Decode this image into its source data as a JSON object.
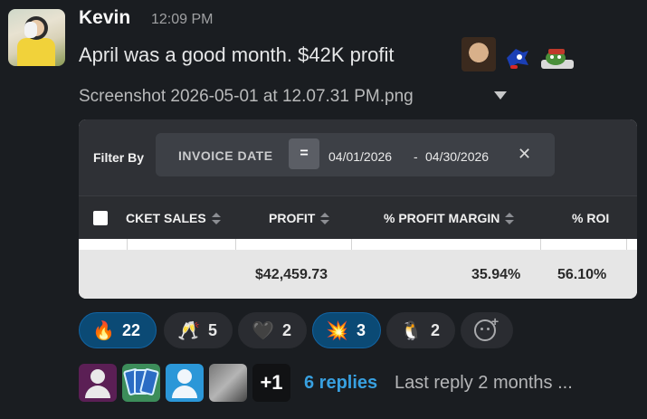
{
  "message": {
    "sender": "Kevin",
    "time": "12:09 PM",
    "text": "April was a good month. $42K profit",
    "inline_emojis": [
      "man-face-emoji",
      "sonic-emoji",
      "pepe-emoji"
    ]
  },
  "attachment": {
    "file_name": "Screenshot 2026-05-01 at 12.07.31 PM.png",
    "filter": {
      "label": "Filter By",
      "field": "INVOICE DATE",
      "operator": "=",
      "from": "04/01/2026",
      "separator": "-",
      "to": "04/30/2026",
      "clear": "✕"
    },
    "table": {
      "columns": [
        "CKET SALES",
        "PROFIT",
        "% PROFIT MARGIN",
        "% ROI"
      ],
      "totals": {
        "profit": "$42,459.73",
        "profit_margin": "35.94%",
        "roi": "56.10%"
      }
    }
  },
  "reactions": [
    {
      "emoji": "🔥",
      "count": "22",
      "active": true
    },
    {
      "emoji": "🥂",
      "count": "5",
      "active": false
    },
    {
      "emoji": "🖤",
      "count": "2",
      "active": false
    },
    {
      "emoji": "💥",
      "count": "3",
      "active": true
    },
    {
      "emoji": "🐧",
      "count": "2",
      "active": false
    }
  ],
  "thread": {
    "more_participants": "+1",
    "replies": "6 replies",
    "last_reply": "Last reply 2 months ..."
  },
  "colors": {
    "background": "#1a1d21",
    "link": "#38a0e0",
    "active_reaction": "#0b4a75"
  }
}
